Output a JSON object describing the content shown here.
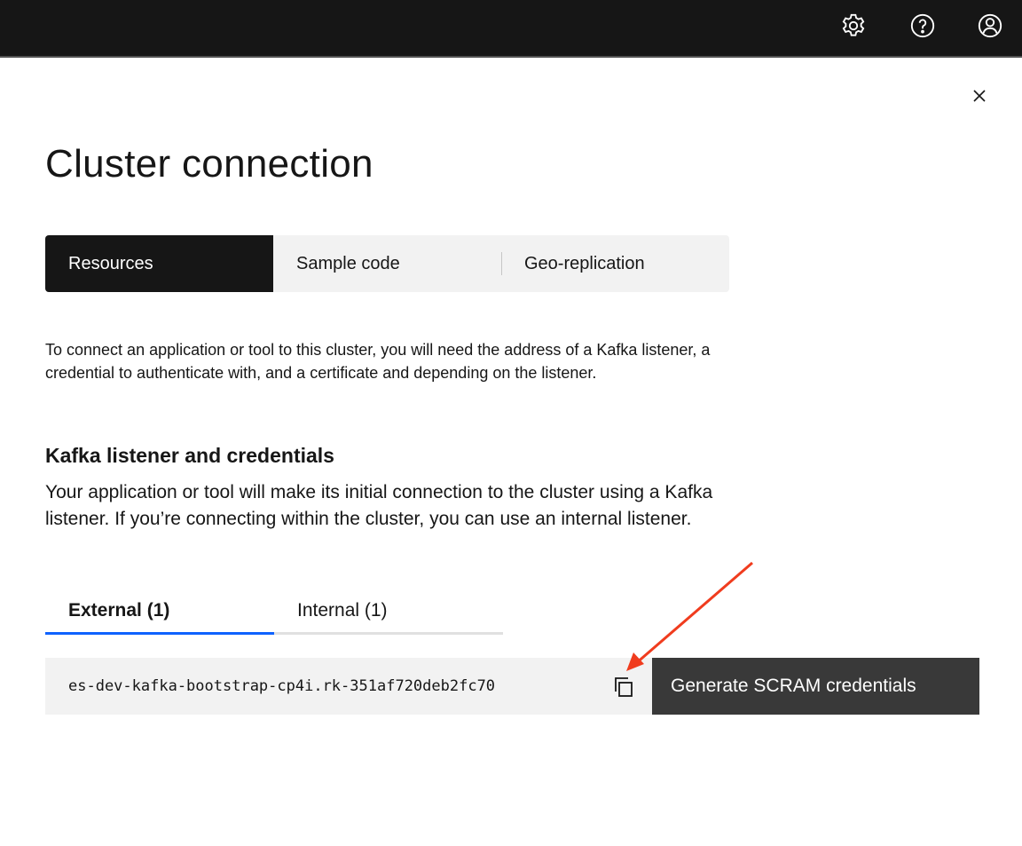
{
  "header": {
    "icons": [
      "settings-icon",
      "help-icon",
      "user-avatar-icon"
    ]
  },
  "panel": {
    "title": "Cluster connection",
    "tabs": [
      {
        "label": "Resources",
        "active": true
      },
      {
        "label": "Sample code",
        "active": false
      },
      {
        "label": "Geo-replication",
        "active": false
      }
    ],
    "intro": "To connect an application or tool to this cluster, you will need the address of a Kafka listener, a credential to authenticate with, and a certificate and depending on the listener.",
    "section_title": "Kafka listener and credentials",
    "section_desc": "Your application or tool will make its initial connection to the cluster using a Kafka listener. If you’re connecting within the cluster, you can use an internal listener.",
    "listener_tabs": [
      {
        "label": "External (1)",
        "active": true
      },
      {
        "label": "Internal (1)",
        "active": false
      }
    ],
    "address": "es-dev-kafka-bootstrap-cp4i.rk-351af720deb2fc70",
    "generate_label": "Generate SCRAM credentials"
  },
  "annotation": {
    "arrow_color": "#f03c1e"
  }
}
